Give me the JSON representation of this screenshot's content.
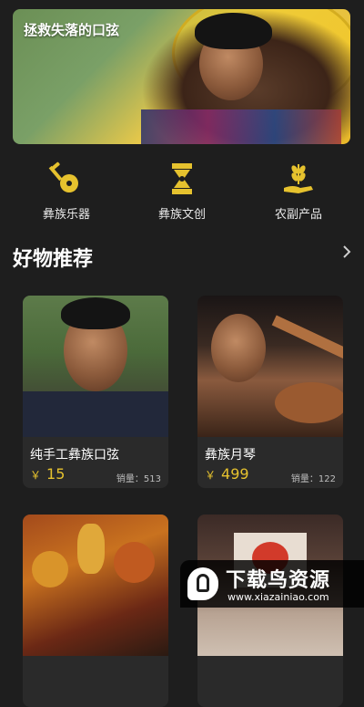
{
  "banner": {
    "title": "拯救失落的口弦"
  },
  "categories": [
    {
      "label": "彝族乐器",
      "icon": "lute-icon"
    },
    {
      "label": "彝族文创",
      "icon": "totem-icon"
    },
    {
      "label": "农副产品",
      "icon": "wheat-hand-icon"
    }
  ],
  "section": {
    "title": "好物推荐",
    "more_icon": "chevron-right-icon"
  },
  "products": [
    {
      "name": "纯手工彝族口弦",
      "currency": "￥",
      "price": "15",
      "sales": "销量：513"
    },
    {
      "name": "彝族月琴",
      "currency": "￥",
      "price": "499",
      "sales": "销量：122"
    },
    {
      "name": "",
      "currency": "",
      "price": "",
      "sales": ""
    },
    {
      "name": "",
      "currency": "",
      "price": "",
      "sales": ""
    }
  ],
  "watermark": {
    "brand": "下载鸟资源",
    "url": "www.xiazainiao.com"
  },
  "colors": {
    "background": "#1e1e1e",
    "card": "#2a2a2a",
    "accent": "#e6c22e"
  }
}
